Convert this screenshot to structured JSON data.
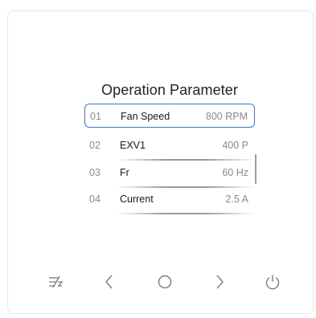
{
  "screen": {
    "title": "Operation Parameter",
    "rows": [
      {
        "num": "01",
        "name": "Fan Speed",
        "value": "800 RPM",
        "selected": true
      },
      {
        "num": "02",
        "name": "EXV1",
        "value": "400 P",
        "selected": false
      },
      {
        "num": "03",
        "name": "Fr",
        "value": "60 Hz",
        "selected": false
      },
      {
        "num": "04",
        "name": "Current",
        "value": "2.5 A",
        "selected": false
      }
    ]
  },
  "buttons": [
    {
      "icon": "mode-icon"
    },
    {
      "icon": "chevron-left-icon"
    },
    {
      "icon": "circle-icon"
    },
    {
      "icon": "chevron-right-icon"
    },
    {
      "icon": "power-icon"
    }
  ],
  "colors": {
    "selection_border": "#3c78c8",
    "icon": "#7a7a7a",
    "text_primary": "#1a1a1a",
    "text_secondary": "#8a8a8a"
  }
}
